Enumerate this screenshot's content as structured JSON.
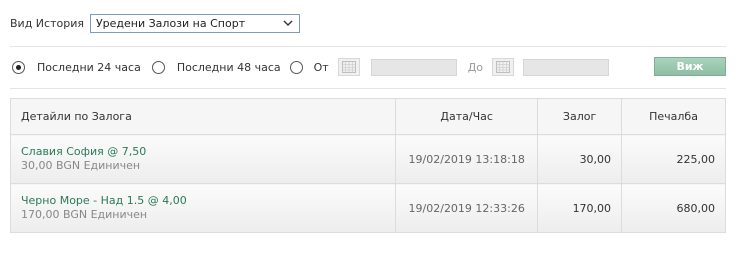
{
  "history": {
    "label": "Вид История",
    "selected": "Уредени Залози на Спорт"
  },
  "filters": {
    "last24": "Последни 24 часа",
    "last48": "Последни 48 часа",
    "from": "От",
    "to": "До",
    "selected": "last24",
    "view_button": "Виж"
  },
  "table": {
    "headers": {
      "details": "Детайли по Залога",
      "datetime": "Дата/Час",
      "stake": "Залог",
      "winnings": "Печалба"
    },
    "rows": [
      {
        "selection": "Славия София @ 7,50",
        "summary": "30,00 BGN Единичен",
        "datetime": "19/02/2019 13:18:18",
        "stake": "30,00",
        "winnings": "225,00"
      },
      {
        "selection": "Черно Море - Над 1.5 @ 4,00",
        "summary": "170,00 BGN Единичен",
        "datetime": "19/02/2019 12:33:26",
        "stake": "170,00",
        "winnings": "680,00"
      }
    ]
  },
  "icons": {
    "dropdown": "chevron-down-icon",
    "calendar": "calendar-icon"
  },
  "colors": {
    "view_button": "#98c6ad",
    "selection_text": "#2b7a57",
    "select_border": "#7f9db9"
  }
}
